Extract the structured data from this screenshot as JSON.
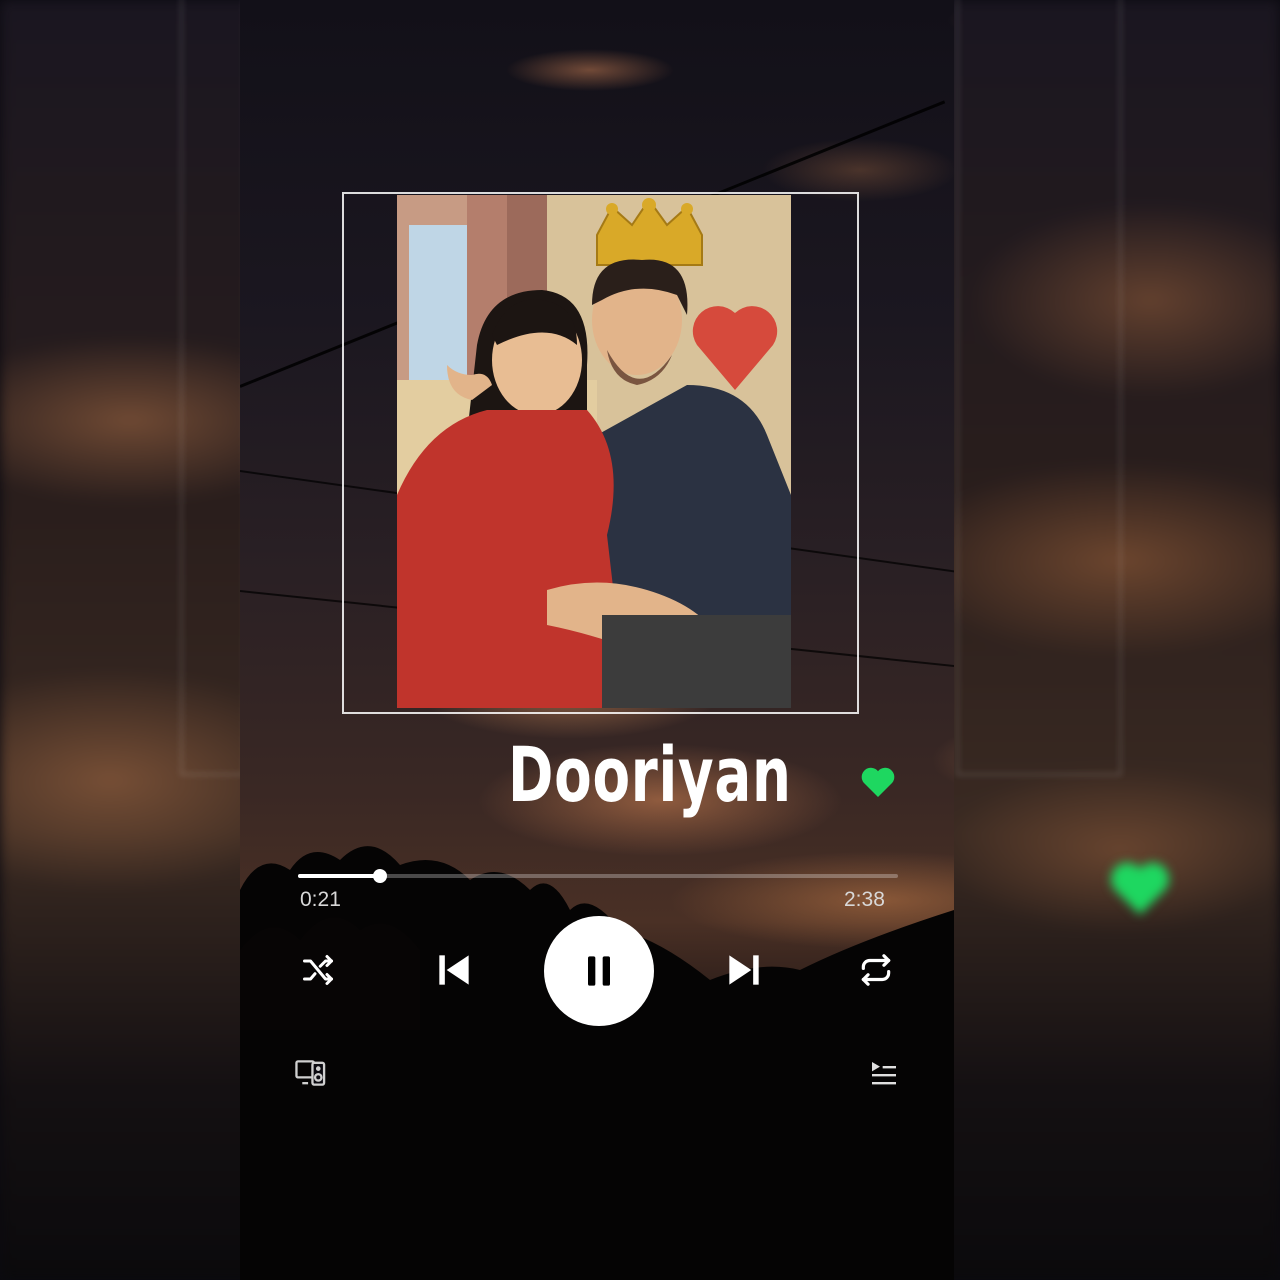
{
  "player": {
    "song_title": "Dooriyan",
    "liked": true,
    "elapsed": "0:21",
    "duration": "2:38",
    "progress_fraction": 0.1373,
    "state": "playing"
  },
  "controls": {
    "shuffle_icon": "shuffle-icon",
    "previous_icon": "skip-previous-icon",
    "pause_icon": "pause-icon",
    "next_icon": "skip-next-icon",
    "repeat_icon": "repeat-icon",
    "devices_icon": "connect-devices-icon",
    "queue_icon": "queue-icon"
  },
  "colors": {
    "accent_green": "#1ed760",
    "text_white": "#ffffff",
    "time_text": "#d8d8d8"
  }
}
